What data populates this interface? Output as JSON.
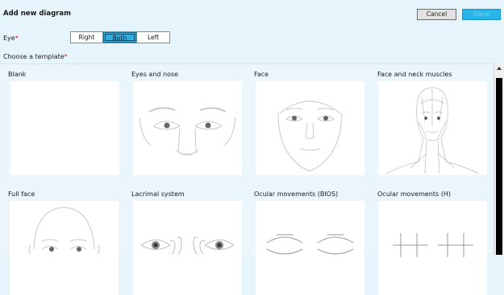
{
  "dialog": {
    "title": "Add new diagram",
    "cancel_label": "Cancel",
    "done_label": "Done"
  },
  "eye": {
    "label": "Eye",
    "required_mark": "*",
    "options": [
      "Right",
      "Both",
      "Left"
    ],
    "selected": "Both"
  },
  "template_prompt": {
    "label": "Choose a template",
    "required_mark": "*"
  },
  "templates": [
    {
      "label": "Blank",
      "icon": "blank-template-icon"
    },
    {
      "label": "Eyes and nose",
      "icon": "eyes-and-nose-icon"
    },
    {
      "label": "Face",
      "icon": "face-icon"
    },
    {
      "label": "Face and neck muscles",
      "icon": "face-and-neck-muscles-icon"
    },
    {
      "label": "Full face",
      "icon": "full-face-icon"
    },
    {
      "label": "Lacrimal system",
      "icon": "lacrimal-system-icon"
    },
    {
      "label": "Ocular movements (BIOS)",
      "icon": "ocular-movements-bios-icon"
    },
    {
      "label": "Ocular movements (H)",
      "icon": "ocular-movements-h-icon"
    }
  ]
}
